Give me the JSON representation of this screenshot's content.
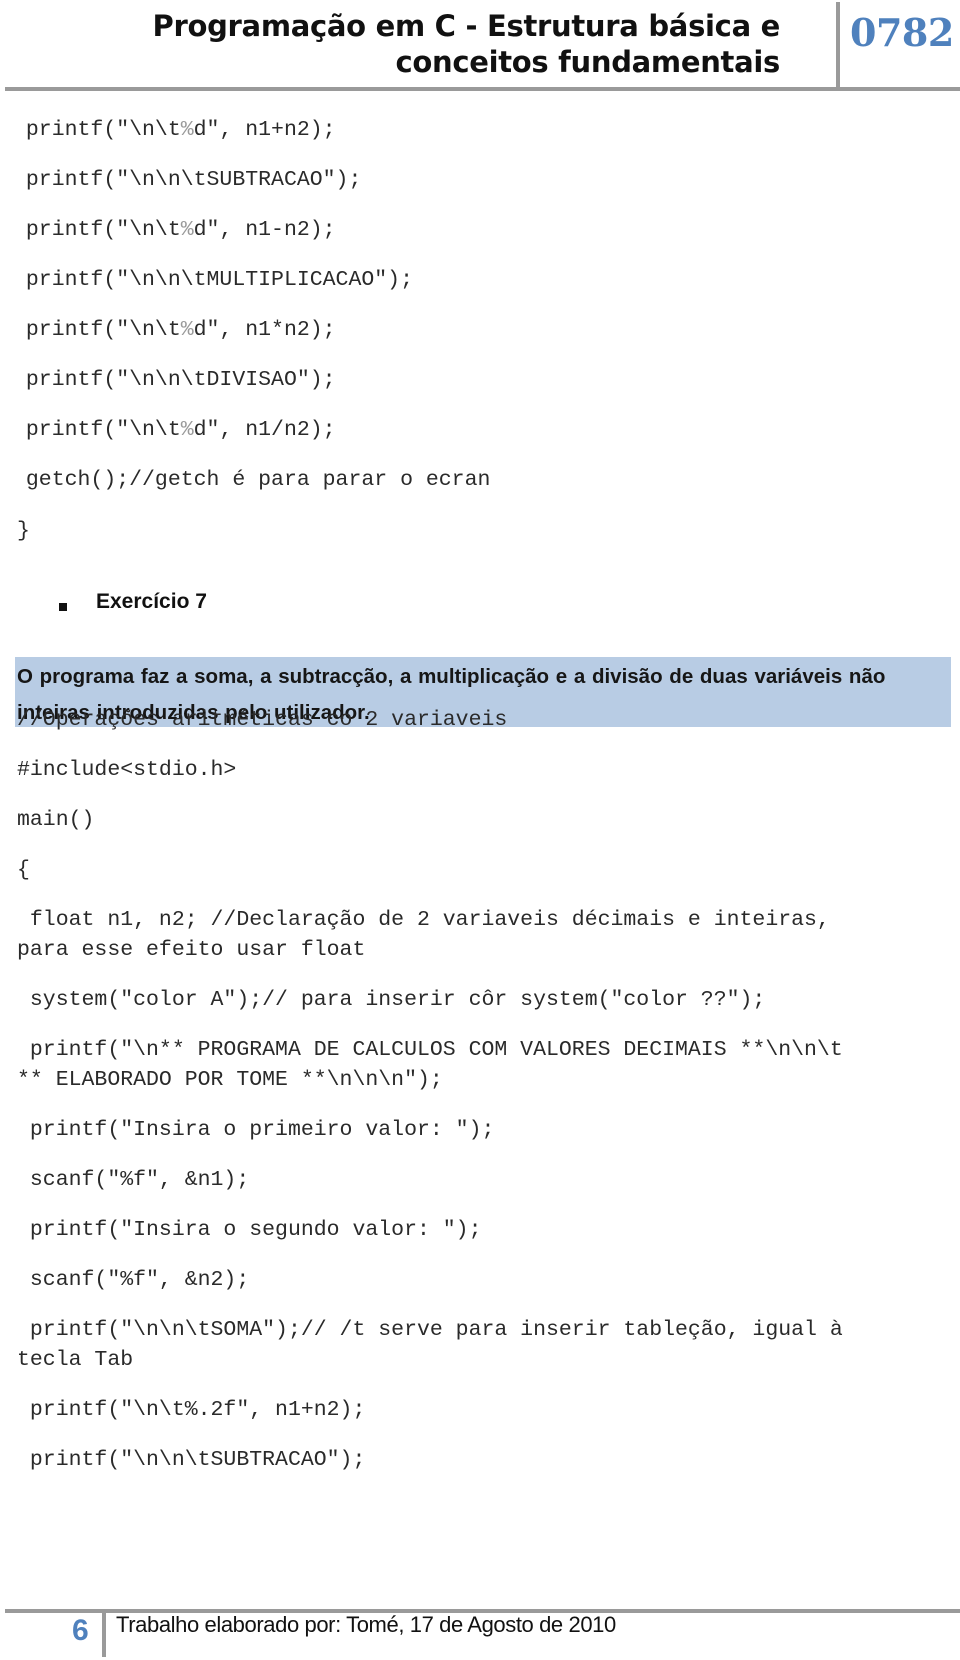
{
  "header": {
    "title_line1": "Programação em C - Estrutura básica e",
    "title_line2": "conceitos fundamentais",
    "module_code": "0782",
    "accent_color": "#4f81bd"
  },
  "top_code": [
    {
      "pre": " printf(\"\\n\\t",
      "pct": "%",
      "post": "d\", n1+n2);"
    },
    {
      "pre": " printf(\"\\n\\n\\tSUBTRACAO\");",
      "pct": "",
      "post": ""
    },
    {
      "pre": " printf(\"\\n\\t",
      "pct": "%",
      "post": "d\", n1-n2);"
    },
    {
      "pre": " printf(\"\\n\\n\\tMULTIPLICACAO\");",
      "pct": "",
      "post": ""
    },
    {
      "pre": " printf(\"\\n\\t",
      "pct": "%",
      "post": "d\", n1*n2);"
    },
    {
      "pre": " printf(\"\\n\\n\\tDIVISAO\");",
      "pct": "",
      "post": ""
    },
    {
      "pre": " printf(\"\\n\\t",
      "pct": "%",
      "post": "d\", n1/n2);"
    },
    {
      "pre": " getch();//getch é para parar o ecran",
      "pct": "",
      "post": ""
    },
    {
      "pre": "}",
      "pct": "",
      "post": ""
    }
  ],
  "exercise": {
    "label": "Exercício 7",
    "description_line1": "O programa faz a soma, a subtracção, a multiplicação e a divisão de duas variáveis não",
    "description_line2": "inteiras introduzidas pelo utilizador.",
    "highlight_color": "#b8cce4"
  },
  "bottom_code": [
    {
      "l1": "//Operações aritméticas co 2 variaveis",
      "l2": ""
    },
    {
      "l1": "#include<stdio.h>",
      "l2": ""
    },
    {
      "l1": "main()",
      "l2": ""
    },
    {
      "l1": "{",
      "l2": ""
    },
    {
      "l1": " float n1, n2; //Declaração de 2 variaveis décimais e inteiras,",
      "l2": "para esse efeito usar float"
    },
    {
      "l1": " system(\"color A\");// para inserir côr system(\"color ??\");",
      "l2": ""
    },
    {
      "l1": " printf(\"\\n** PROGRAMA DE CALCULOS COM VALORES DECIMAIS **\\n\\n\\t",
      "l2": "** ELABORADO POR TOME **\\n\\n\\n\");"
    },
    {
      "l1": " printf(\"Insira o primeiro valor: \");",
      "l2": ""
    },
    {
      "l1": " scanf(\"%f\", &n1);",
      "l2": ""
    },
    {
      "l1": " printf(\"Insira o segundo valor: \");",
      "l2": ""
    },
    {
      "l1": " scanf(\"%f\", &n2);",
      "l2": ""
    },
    {
      "l1": " printf(\"\\n\\n\\tSOMA\");// /t serve para inserir tableção, igual à",
      "l2": "tecla Tab"
    },
    {
      "l1": " printf(\"\\n\\t%.2f\", n1+n2);",
      "l2": ""
    },
    {
      "l1": " printf(\"\\n\\n\\tSUBTRACAO\");",
      "l2": ""
    }
  ],
  "footer": {
    "page_number": "6",
    "text": "Trabalho elaborado por: Tomé, 17 de Agosto de 2010"
  }
}
